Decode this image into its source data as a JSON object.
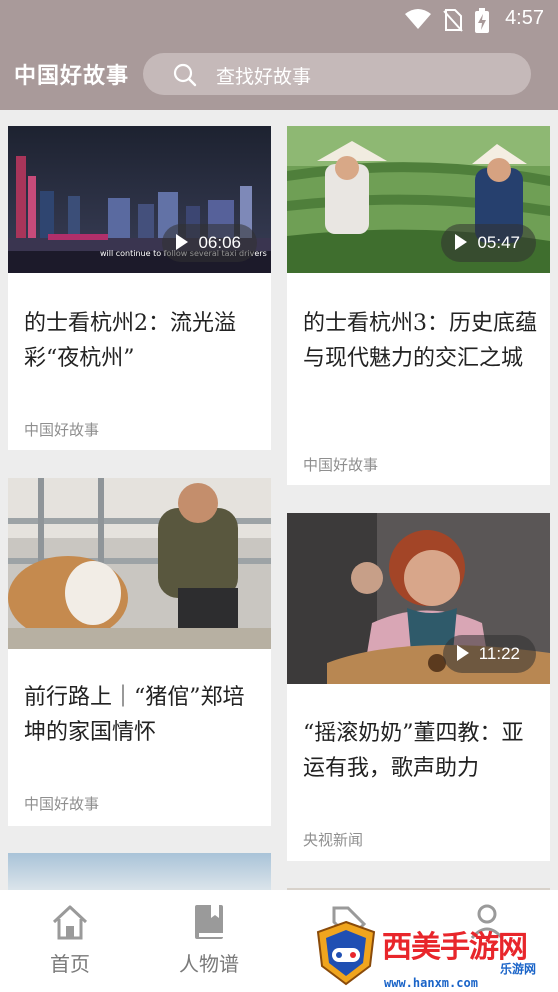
{
  "status_bar": {
    "time": "4:57"
  },
  "header": {
    "app_title": "中国好故事",
    "search_placeholder": "查找好故事"
  },
  "feed": {
    "cards": [
      {
        "title": "的士看杭州2：流光溢彩“夜杭州”",
        "source": "中国好故事",
        "duration": "06:06",
        "subtitle_text": "will continue to follow several taxi drivers"
      },
      {
        "title": "的士看杭州3：历史底蕴与现代魅力的交汇之城",
        "source": "中国好故事",
        "duration": "05:47"
      },
      {
        "title": "前行路上｜“猪倌”郑培坤的家国情怀",
        "source": "中国好故事"
      },
      {
        "title": "“摇滚奶奶”董四教：亚运有我，歌声助力",
        "source": "央视新闻",
        "duration": "11:22"
      }
    ]
  },
  "bottom_nav": {
    "items": [
      {
        "label": "首页",
        "icon": "home-icon"
      },
      {
        "label": "人物谱",
        "icon": "book-icon"
      },
      {
        "label": "",
        "icon": "tag-icon"
      },
      {
        "label": "",
        "icon": "person-icon"
      }
    ]
  },
  "watermark": {
    "brand": "西美手游网",
    "sub": "乐游网",
    "url": "www.hanxm.com"
  },
  "colors": {
    "header_bg": "#a99a9a",
    "search_bg": "#c5b9b9",
    "page_bg": "#ededed",
    "watermark_red": "#e8262b",
    "watermark_blue": "#1a64c8"
  }
}
